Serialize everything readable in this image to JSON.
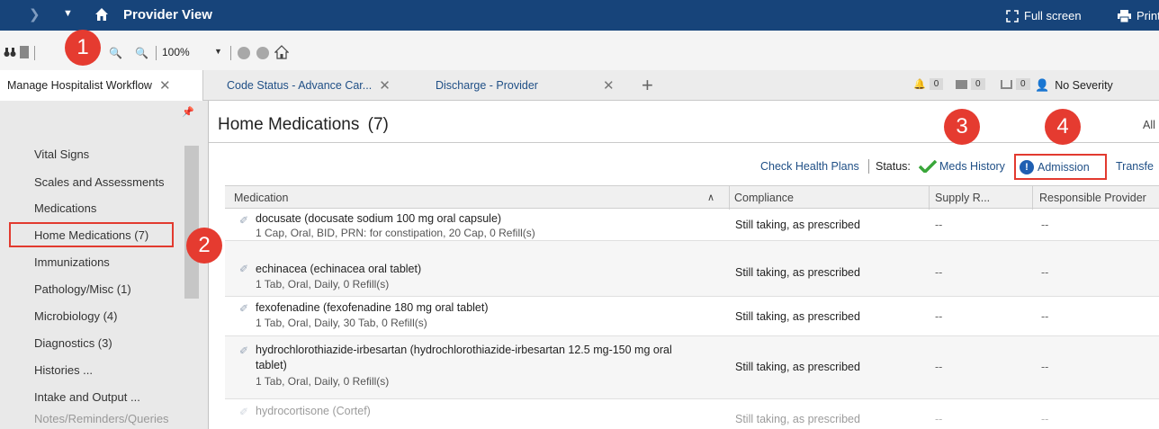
{
  "titlebar": {
    "title": "Provider View",
    "fullscreen_label": "Full screen",
    "print_label": "Print"
  },
  "toolbar": {
    "zoom_value": "100%"
  },
  "annotations": [
    "1",
    "2",
    "3",
    "4"
  ],
  "tabs": [
    {
      "label": "Manage Hospitalist Workflow",
      "active": true
    },
    {
      "label": "Code Status - Advance Car...",
      "active": false
    },
    {
      "label": "Discharge - Provider",
      "active": false
    }
  ],
  "header_counters": [
    "0",
    "0",
    "0"
  ],
  "severity_label": "No Severity",
  "sidebar": {
    "items": [
      "Vital Signs",
      "Scales and Assessments",
      "Medications",
      "Home Medications (7)",
      "Immunizations",
      "Pathology/Misc (1)",
      "Microbiology (4)",
      "Diagnostics (3)",
      "Histories ...",
      "Intake and Output ...",
      "Notes/Reminders/Queries"
    ]
  },
  "main": {
    "title": "Home Medications",
    "count": "(7)",
    "all_label": "All",
    "check_health_plans": "Check Health Plans",
    "status_label": "Status:",
    "meds_history": "Meds History",
    "admission": "Admission",
    "transfer": "Transfe"
  },
  "table": {
    "columns": [
      "Medication",
      "Compliance",
      "Supply R...",
      "Responsible Provider"
    ],
    "rows": [
      {
        "name": "docusate (docusate sodium 100 mg oral capsule)",
        "detail": "1 Cap, Oral, BID, PRN: for constipation, 20 Cap, 0 Refill(s)",
        "compliance": "Still taking, as prescribed",
        "supply": "--",
        "provider": "--"
      },
      {
        "name": "echinacea (echinacea oral tablet)",
        "detail": "1 Tab, Oral, Daily, 0 Refill(s)",
        "compliance": "Still taking, as prescribed",
        "supply": "--",
        "provider": "--"
      },
      {
        "name": "fexofenadine (fexofenadine 180 mg oral tablet)",
        "detail": "1 Tab, Oral, Daily, 30 Tab, 0 Refill(s)",
        "compliance": "Still taking, as prescribed",
        "supply": "--",
        "provider": "--"
      },
      {
        "name": "hydrochlorothiazide-irbesartan (hydrochlorothiazide-irbesartan 12.5 mg-150 mg oral",
        "name2": "tablet)",
        "detail": "1 Tab, Oral, Daily, 0 Refill(s)",
        "compliance": "Still taking, as prescribed",
        "supply": "--",
        "provider": "--"
      },
      {
        "name": "hydrocortisone (Cortef)",
        "detail": "",
        "compliance": "Still taking, as prescribed",
        "supply": "--",
        "provider": "--"
      }
    ]
  },
  "colors": {
    "titlebar": "#17447a",
    "link": "#1f4f86",
    "annotation_red": "#e53b30",
    "check_green": "#3aa63a"
  }
}
